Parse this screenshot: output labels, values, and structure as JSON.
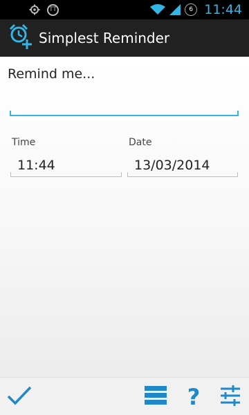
{
  "status_bar": {
    "time": "11:44",
    "notification_count": "6",
    "left_icons": [
      "settings-gear-icon",
      "app-badge-icon"
    ],
    "right_icons": [
      "wifi-icon",
      "signal-icon",
      "notification-count-icon"
    ],
    "badge_text": "TT"
  },
  "app_bar": {
    "title": "Simplest Reminder",
    "icon": "alarm-clock-plus-icon"
  },
  "form": {
    "remind_label": "Remind me...",
    "remind_value": "",
    "time_label": "Time",
    "time_value": "11:44",
    "date_label": "Date",
    "date_value": "13/03/2014"
  },
  "bottom_bar": {
    "help_label": "?",
    "icons": [
      "checkmark-icon",
      "list-icon",
      "help-icon",
      "settings-sliders-icon"
    ]
  },
  "colors": {
    "accent": "#33b5e5",
    "icon_blue": "#1e88c8",
    "action_bar_bg": "#212121"
  }
}
